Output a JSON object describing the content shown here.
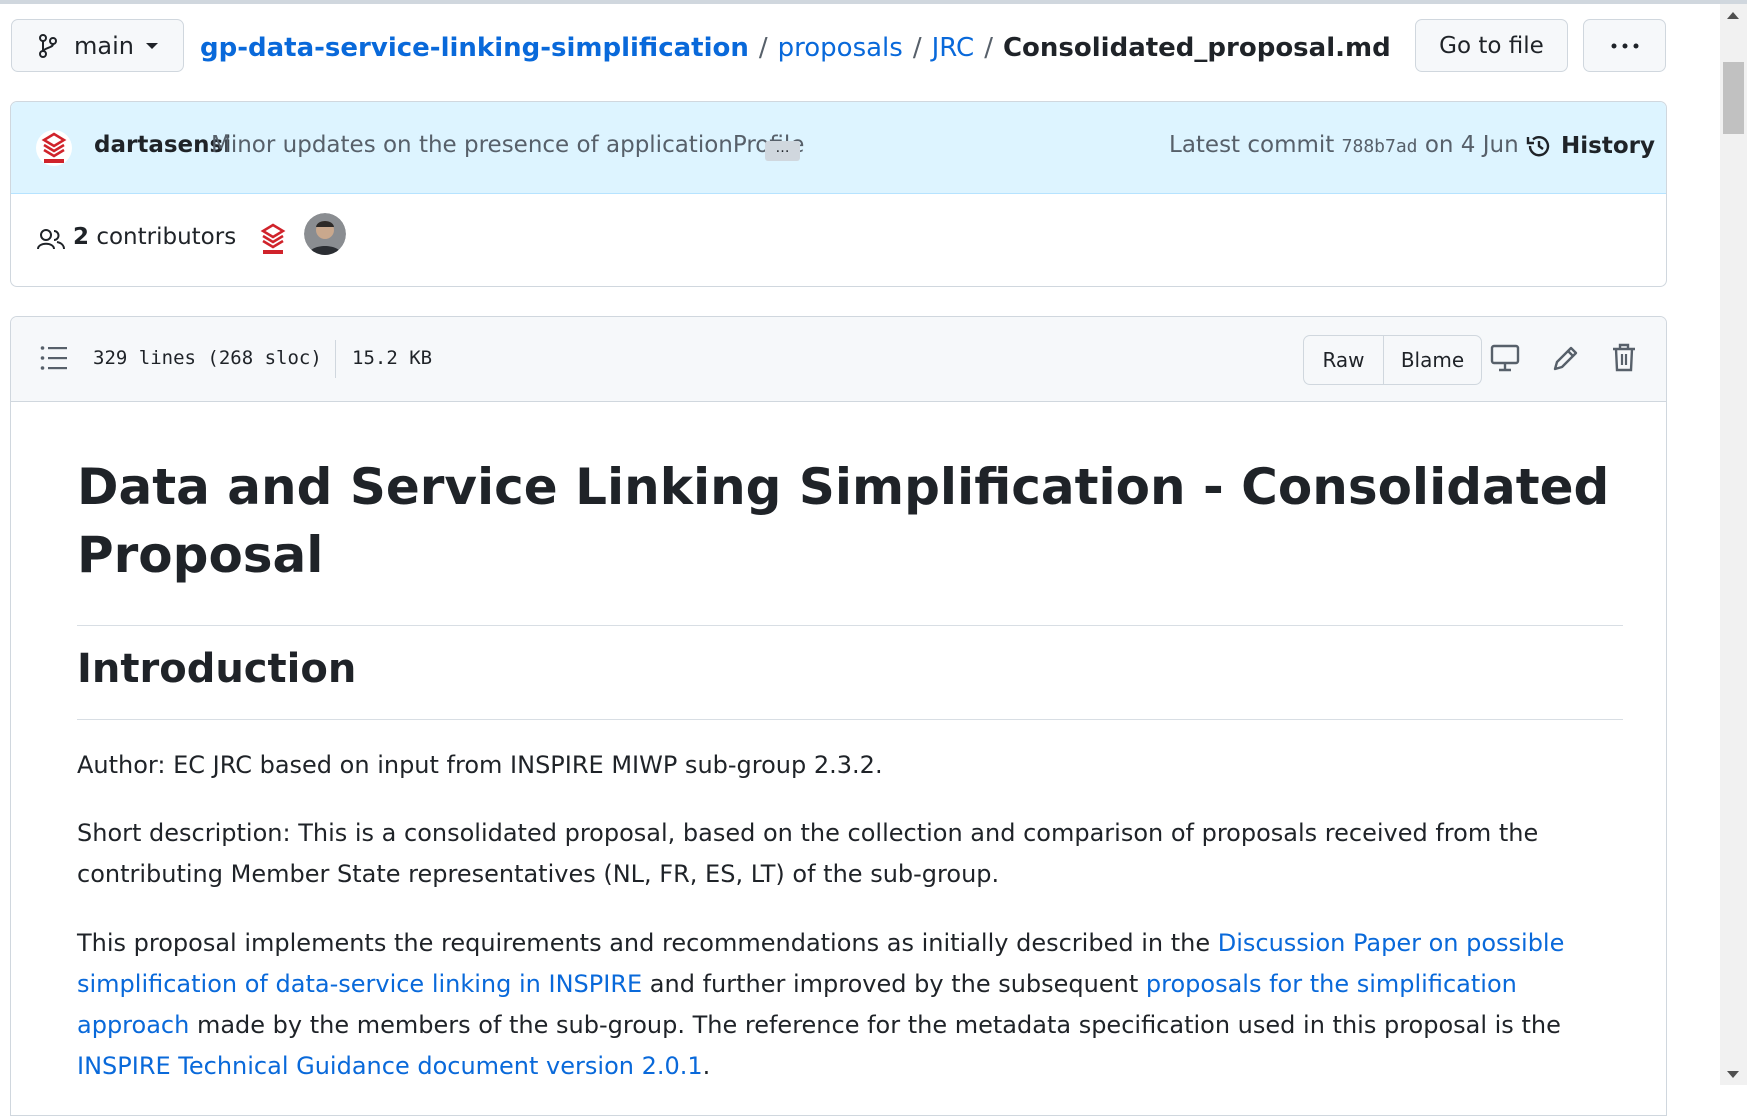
{
  "header": {
    "branch_label": "main",
    "breadcrumb": {
      "repo": "gp-data-service-linking-simplification",
      "sep": "/",
      "folder1": "proposals",
      "folder2": "JRC",
      "file": "Consolidated_proposal.md"
    },
    "goto_label": "Go to file",
    "more_label": "···"
  },
  "commit": {
    "author": "dartasensi",
    "message": "Minor updates on the presence of applicationProfile",
    "ellipsis": "…",
    "latest_prefix": "Latest commit",
    "sha": "788b7ad",
    "date": "on 4 Jun",
    "history_label": "History"
  },
  "contributors": {
    "count": "2",
    "label": "contributors"
  },
  "file_info": {
    "lines": "329 lines (268 sloc)",
    "size": "15.2 KB",
    "raw_label": "Raw",
    "blame_label": "Blame"
  },
  "content": {
    "title": "Data and Service Linking Simplification - Consolidated Proposal",
    "h2_intro": "Introduction",
    "author_line": "Author: EC JRC based on input from INSPIRE MIWP sub-group 2.3.2.",
    "short_desc": "Short description: This is a consolidated proposal, based on the collection and comparison of proposals received from the contributing Member State representatives (NL, FR, ES, LT) of the sub-group.",
    "p3_a": "This proposal implements the requirements and recommendations as initially described in the ",
    "p3_link1": "Discussion Paper on possible simplification of data-service linking in INSPIRE",
    "p3_b": " and further improved by the subsequent ",
    "p3_link2": "proposals for the simplification approach",
    "p3_c": " made by the members of the sub-group. The reference for the metadata specification used in this proposal is the ",
    "p3_link3": "INSPIRE Technical Guidance document version 2.0.1",
    "p3_d": "."
  },
  "colors": {
    "link": "#0969da",
    "commit_bg": "#ddf4ff",
    "border": "#d0d7de",
    "text": "#1f2328",
    "muted": "#57606a",
    "avatar_red": "#d0232b"
  },
  "icons": {
    "branch": "git-branch-icon",
    "history": "history-clock-icon",
    "people": "people-icon",
    "toc": "list-unordered-icon",
    "display": "desktop-display-icon",
    "edit": "pencil-icon",
    "delete": "trash-icon"
  }
}
